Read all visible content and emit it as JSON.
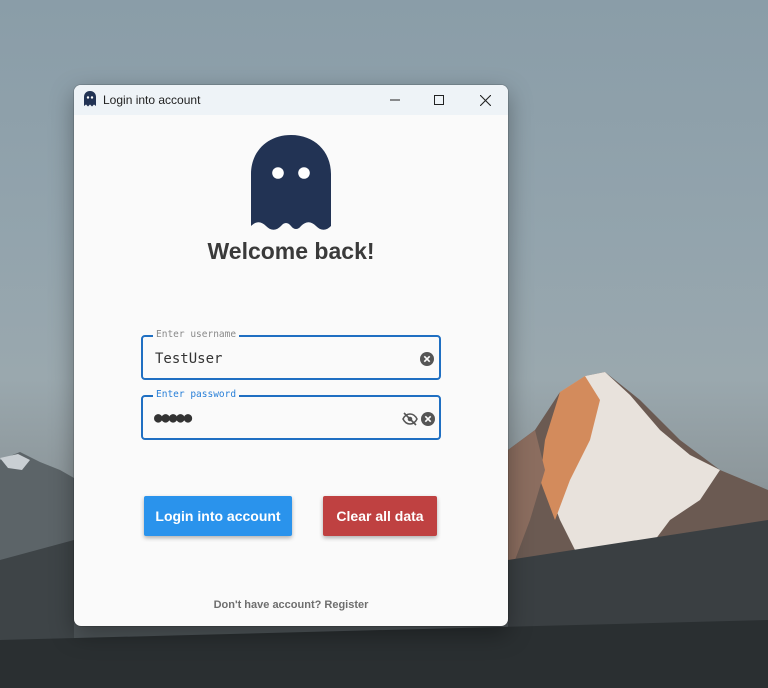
{
  "window": {
    "title": "Login into account"
  },
  "main": {
    "welcome": "Welcome back!",
    "username": {
      "label": "Enter username",
      "value": "TestUser"
    },
    "password": {
      "label": "Enter password",
      "value": "●●●●●"
    },
    "login_button": "Login into account",
    "clear_button": "Clear all data",
    "footer": "Don't have account? Register"
  },
  "colors": {
    "accent": "#1f6fc2",
    "login_button": "#2a93ec",
    "clear_button": "#bf4141",
    "ghost": "#223354"
  }
}
